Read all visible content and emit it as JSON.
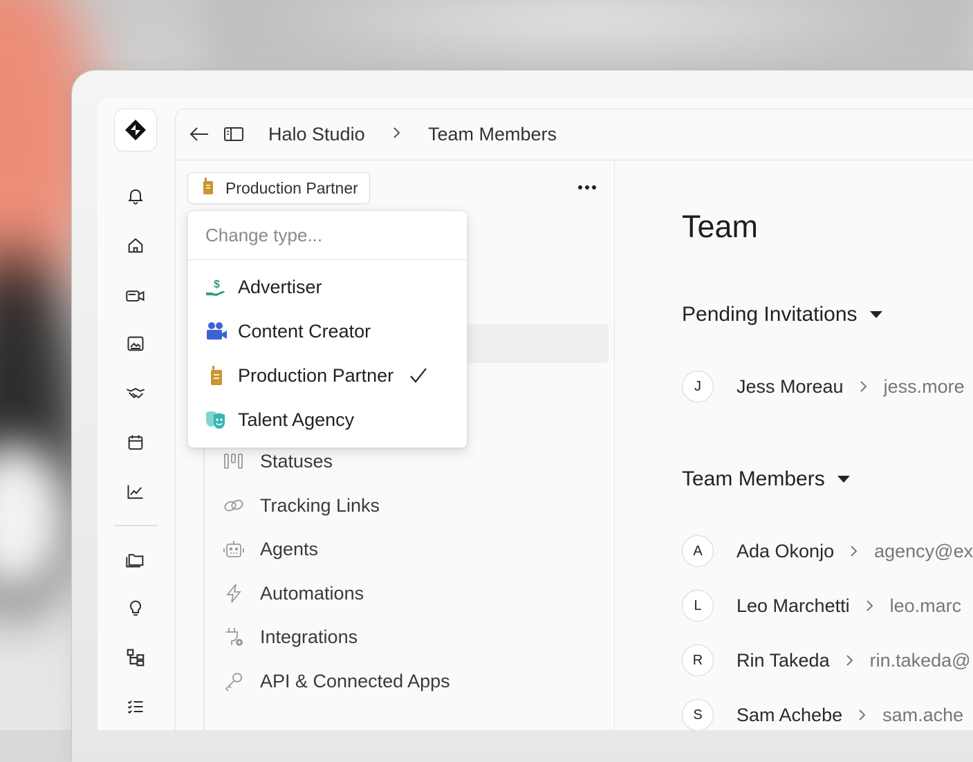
{
  "breadcrumb": {
    "workspace": "Halo Studio",
    "page": "Team Members"
  },
  "org_type": {
    "selected_label": "Production Partner"
  },
  "dropdown": {
    "placeholder": "Change type...",
    "options": [
      {
        "label": "Advertiser",
        "icon": "hand-money-icon",
        "color": "#2f9e76"
      },
      {
        "label": "Content Creator",
        "icon": "video-camera-icon",
        "color": "#3b63d4"
      },
      {
        "label": "Production Partner",
        "icon": "walkie-talkie-icon",
        "color": "#c9962f",
        "selected": true
      },
      {
        "label": "Talent Agency",
        "icon": "theater-masks-icon",
        "color": "#36b7b0"
      }
    ]
  },
  "settings_nav": [
    {
      "label": "Statuses",
      "icon": "columns-icon"
    },
    {
      "label": "Tracking Links",
      "icon": "link-icon"
    },
    {
      "label": "Agents",
      "icon": "robot-icon"
    },
    {
      "label": "Automations",
      "icon": "lightning-icon"
    },
    {
      "label": "Integrations",
      "icon": "plug-icon"
    },
    {
      "label": "API & Connected Apps",
      "icon": "key-icon"
    }
  ],
  "content": {
    "title": "Team",
    "pending": {
      "heading": "Pending Invitations",
      "members": [
        {
          "initial": "J",
          "name": "Jess Moreau",
          "email": "jess.more"
        }
      ]
    },
    "team": {
      "heading": "Team Members",
      "members": [
        {
          "initial": "A",
          "name": "Ada Okonjo",
          "email": "agency@ex"
        },
        {
          "initial": "L",
          "name": "Leo Marchetti",
          "email": "leo.marc"
        },
        {
          "initial": "R",
          "name": "Rin Takeda",
          "email": "rin.takeda@"
        },
        {
          "initial": "S",
          "name": "Sam Achebe",
          "email": "sam.ache"
        }
      ]
    }
  },
  "colors": {
    "accent_gold": "#c9962f",
    "text": "#222222",
    "muted": "#777777"
  }
}
